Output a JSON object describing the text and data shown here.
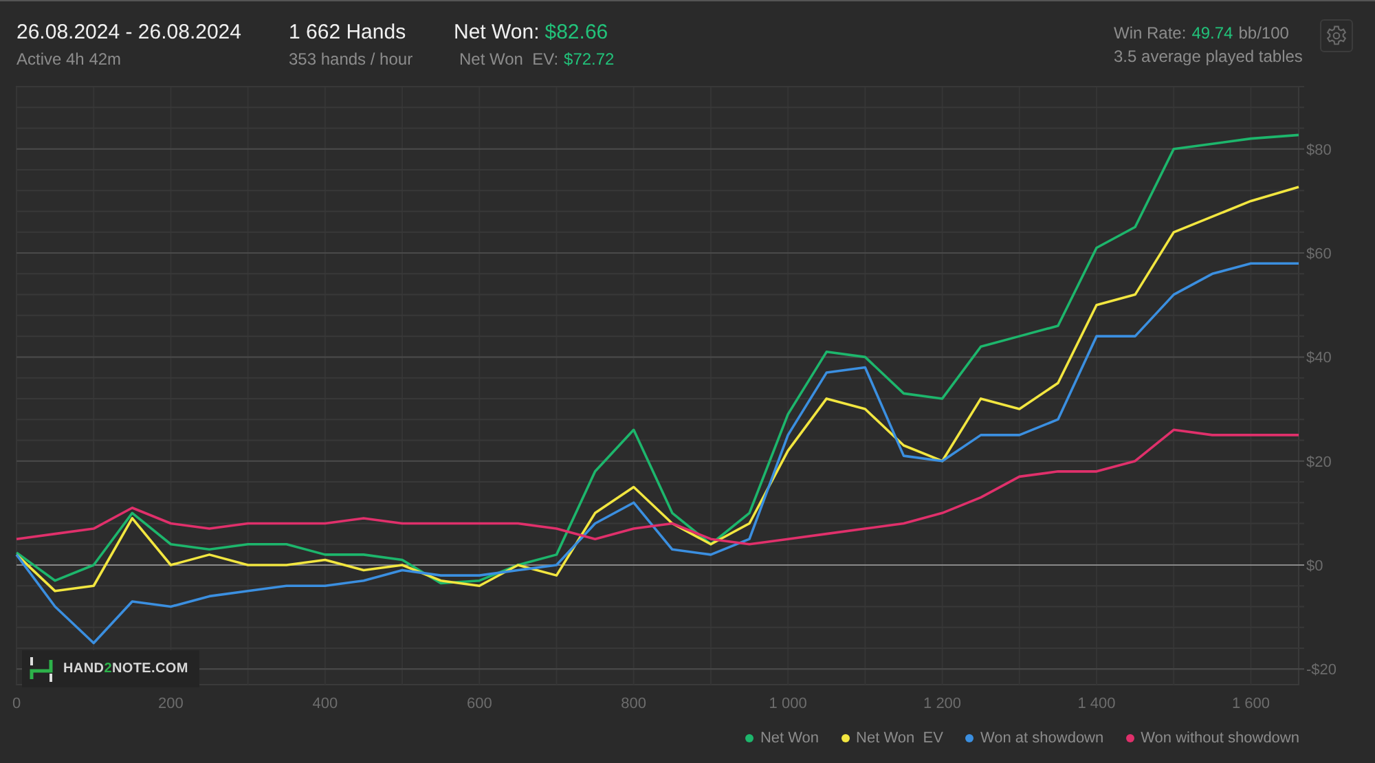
{
  "header": {
    "date_range": "26.08.2024 - 26.08.2024",
    "active": "Active 4h 42m",
    "hands": "1 662 Hands",
    "hands_per_hour": "353 hands / hour",
    "net_won": {
      "label": "Net Won:",
      "value": "$82.66"
    },
    "net_won_ev": {
      "label": "Net Won  EV:",
      "value": "$72.72"
    },
    "win_rate": {
      "label": "Win Rate:",
      "value": "49.74",
      "unit": "bb/100"
    },
    "tables": "3.5 average played tables"
  },
  "logo": [
    {
      "text": "HAND",
      "accent": false
    },
    {
      "text": "2",
      "accent": true
    },
    {
      "text": "NOTE.COM",
      "accent": false
    }
  ],
  "chart_data": {
    "type": "line",
    "x": [
      0,
      50,
      100,
      150,
      200,
      250,
      300,
      350,
      400,
      450,
      500,
      550,
      600,
      650,
      700,
      750,
      800,
      850,
      900,
      950,
      1000,
      1050,
      1100,
      1150,
      1200,
      1250,
      1300,
      1350,
      1400,
      1450,
      1500,
      1550,
      1600,
      1662
    ],
    "grid": true,
    "xlim": [
      0,
      1662
    ],
    "ylim": [
      -23,
      92
    ],
    "xticks": [
      {
        "value": 0,
        "label": "0"
      },
      {
        "value": 200,
        "label": "200"
      },
      {
        "value": 400,
        "label": "400"
      },
      {
        "value": 600,
        "label": "600"
      },
      {
        "value": 800,
        "label": "800"
      },
      {
        "value": 1000,
        "label": "1 000"
      },
      {
        "value": 1200,
        "label": "1 200"
      },
      {
        "value": 1400,
        "label": "1 400"
      },
      {
        "value": 1600,
        "label": "1 600"
      }
    ],
    "yticks": [
      {
        "value": -20,
        "label": "-$20"
      },
      {
        "value": 0,
        "label": "$0"
      },
      {
        "value": 20,
        "label": "$20"
      },
      {
        "value": 40,
        "label": "$40"
      },
      {
        "value": 60,
        "label": "$60"
      },
      {
        "value": 80,
        "label": "$80"
      }
    ],
    "series": [
      {
        "name": "Net Won",
        "color": "#1db66c",
        "values": [
          2.4,
          -3,
          0,
          10,
          4,
          3,
          4,
          4,
          2,
          2,
          1,
          -3.5,
          -3,
          0,
          2,
          18,
          26,
          10,
          4,
          10,
          29,
          41,
          40,
          33,
          32,
          42,
          44,
          46,
          61,
          65,
          80,
          81,
          82,
          82.7
        ]
      },
      {
        "name": "Net Won  EV",
        "color": "#f2e640",
        "values": [
          2,
          -5,
          -4,
          9,
          0,
          2,
          0,
          0,
          1,
          -1,
          0,
          -3,
          -4,
          0,
          -2,
          10,
          15,
          8,
          4,
          8,
          22,
          32,
          30,
          23,
          20,
          32,
          30,
          35,
          50,
          52,
          64,
          67,
          70,
          72.7
        ]
      },
      {
        "name": "Won at showdown",
        "color": "#3b8fe0",
        "values": [
          2,
          -8,
          -15,
          -7,
          -8,
          -6,
          -5,
          -4,
          -4,
          -3,
          -1,
          -2,
          -2,
          -1,
          0,
          8,
          12,
          3,
          2,
          5,
          25,
          37,
          38,
          21,
          20,
          25,
          25,
          28,
          44,
          44,
          52,
          56,
          58,
          58
        ]
      },
      {
        "name": "Won without showdown",
        "color": "#e0306b",
        "values": [
          5,
          6,
          7,
          11,
          8,
          7,
          8,
          8,
          8,
          9,
          8,
          8,
          8,
          8,
          7,
          5,
          7,
          8,
          5,
          4,
          5,
          6,
          7,
          8,
          10,
          13,
          17,
          18,
          18,
          20,
          26,
          25,
          25,
          25
        ]
      }
    ]
  }
}
